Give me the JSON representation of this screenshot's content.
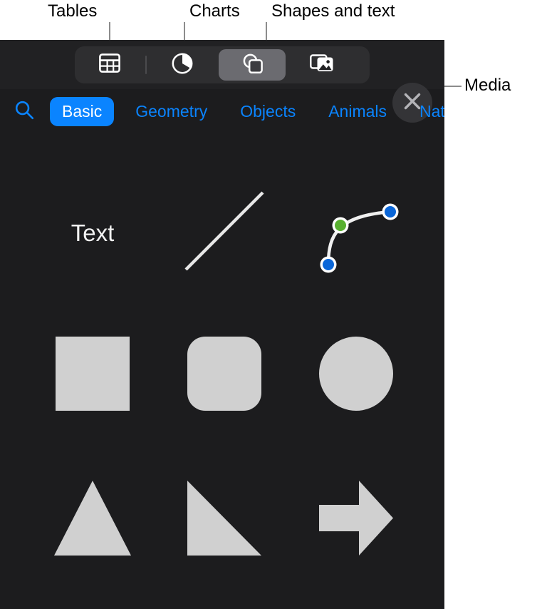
{
  "annotations": [
    {
      "label": "Tables",
      "name": "callout-tables"
    },
    {
      "label": "Charts",
      "name": "callout-charts"
    },
    {
      "label": "Shapes and text",
      "name": "callout-shapes-and-text"
    },
    {
      "label": "Media",
      "name": "callout-media"
    }
  ],
  "panel": {
    "toolbar": {
      "items": [
        {
          "label": "Tables",
          "icon": "table-icon",
          "selected": false
        },
        {
          "label": "Charts",
          "icon": "chart-icon",
          "selected": false
        },
        {
          "label": "Shapes",
          "icon": "shapes-icon",
          "selected": true
        },
        {
          "label": "Media",
          "icon": "media-icon",
          "selected": false
        }
      ],
      "close_label": "Close"
    },
    "categories": {
      "search_icon": "search-icon",
      "tabs": [
        {
          "label": "Basic",
          "active": true
        },
        {
          "label": "Geometry",
          "active": false
        },
        {
          "label": "Objects",
          "active": false
        },
        {
          "label": "Animals",
          "active": false
        },
        {
          "label": "Nat",
          "active": false
        }
      ]
    },
    "shapes": [
      {
        "label": "Text",
        "icon": "text-shape"
      },
      {
        "label": "Line",
        "icon": "line-shape"
      },
      {
        "label": "Curve",
        "icon": "curve-shape"
      },
      {
        "label": "Square",
        "icon": "square-shape"
      },
      {
        "label": "Rounded Square",
        "icon": "rounded-square-shape"
      },
      {
        "label": "Circle",
        "icon": "circle-shape"
      },
      {
        "label": "Triangle",
        "icon": "triangle-shape"
      },
      {
        "label": "Right Triangle",
        "icon": "right-triangle-shape"
      },
      {
        "label": "Arrow",
        "icon": "arrow-shape"
      }
    ],
    "colors": {
      "panel_background": "#1c1c1e",
      "header_background": "#212123",
      "accent": "#0a84ff",
      "shape_fill": "#d0d0d0",
      "segment_selected": "#6b6b70",
      "curve_endpoint": "#0a66d8",
      "curve_control_point": "#58b030"
    }
  }
}
